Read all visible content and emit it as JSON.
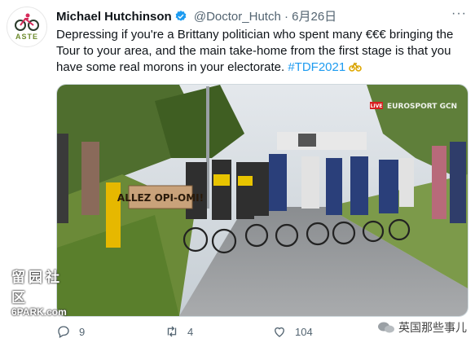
{
  "tweet": {
    "author_name": "Michael Hutchinson",
    "handle": "@Doctor_Hutch",
    "separator": "·",
    "date": "6月26日",
    "text_main": "Depressing if you're a Brittany politician who spent many €€€ bringing the Tour to your area, and the main take-home from the first stage is that you have some real morons in your electorate.",
    "hashtag": "#TDF2021",
    "avatar_label": "ASTE"
  },
  "media": {
    "sign_text": "ALLEZ OPI-OMI!",
    "live_badge": "LIVE",
    "broadcaster": "EUROSPORT GCN"
  },
  "watermark": {
    "cjk": "留园社区",
    "latin": "6PARK.com"
  },
  "actions": {
    "replies": "9",
    "retweets": "4",
    "likes": "104"
  },
  "source_stamp": "英国那些事儿",
  "colors": {
    "link": "#1d9bf0",
    "verified": "#1d9bf0",
    "text": "#0f1419",
    "muted": "#536471"
  }
}
